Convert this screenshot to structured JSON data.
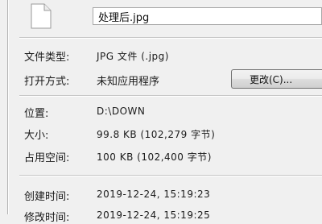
{
  "file": {
    "name": "处理后.jpg",
    "icon": "blank-document-icon"
  },
  "properties": {
    "type_label": "文件类型:",
    "type_value": "JPG 文件 (.jpg)",
    "opens_with_label": "打开方式:",
    "opens_with_value": "未知应用程序",
    "change_button": "更改(C)...",
    "location_label": "位置:",
    "location_value": "D:\\DOWN",
    "size_label": "大小:",
    "size_value": "99.8 KB (102,279 字节)",
    "size_on_disk_label": "占用空间:",
    "size_on_disk_value": "100 KB (102,400 字节)",
    "created_label": "创建时间:",
    "created_value": "2019-12-24, 15:19:23",
    "modified_label": "修改时间:",
    "modified_value": "2019-12-24, 15:19:25"
  }
}
